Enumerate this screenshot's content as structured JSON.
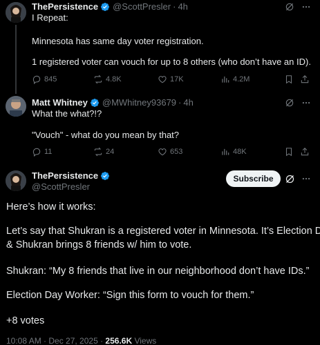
{
  "tweets": [
    {
      "name": "ThePersistence",
      "handle": "@ScottPresler",
      "time": "4h",
      "lines": [
        "I Repeat:",
        "Minnesota has same day voter registration.",
        "1 registered voter can vouch for up to 8 others (who don’t have an ID)."
      ],
      "stats": {
        "replies": "845",
        "reposts": "4.8K",
        "likes": "17K",
        "views": "4.2M"
      }
    },
    {
      "name": "Matt Whitney",
      "handle": "@MWhitney93679",
      "time": "4h",
      "lines": [
        "What the what?!?",
        "\"Vouch\" - what do you mean by that?"
      ],
      "stats": {
        "replies": "11",
        "reposts": "24",
        "likes": "653",
        "views": "48K"
      }
    }
  ],
  "main": {
    "name": "ThePersistence",
    "handle": "@ScottPresler",
    "subscribe_label": "Subscribe",
    "paragraphs": [
      "Here’s how it works:",
      "Let’s say that Shukran is a registered voter in Minnesota. It’s Election Day",
      "& Shukran brings 8 friends w/ him to vote.",
      "Shukran: “My 8 friends that live in our neighborhood don’t have IDs.”",
      "Election Day Worker: “Sign this form to vouch for them.”",
      "+8 votes"
    ],
    "timestamp": "10:08 AM · Dec 27, 2025 · ",
    "views_count": "256.6K",
    "views_label": " Views"
  },
  "icons": [
    "verified-badge-icon",
    "grok-icon",
    "more-icon",
    "reply-icon",
    "repost-icon",
    "like-icon",
    "views-icon",
    "bookmark-icon",
    "share-icon"
  ],
  "colors": {
    "background": "#000000",
    "text": "#e7e9ea",
    "muted": "#71767b",
    "verified": "#1d9bf0",
    "button": "#eff3f4"
  }
}
